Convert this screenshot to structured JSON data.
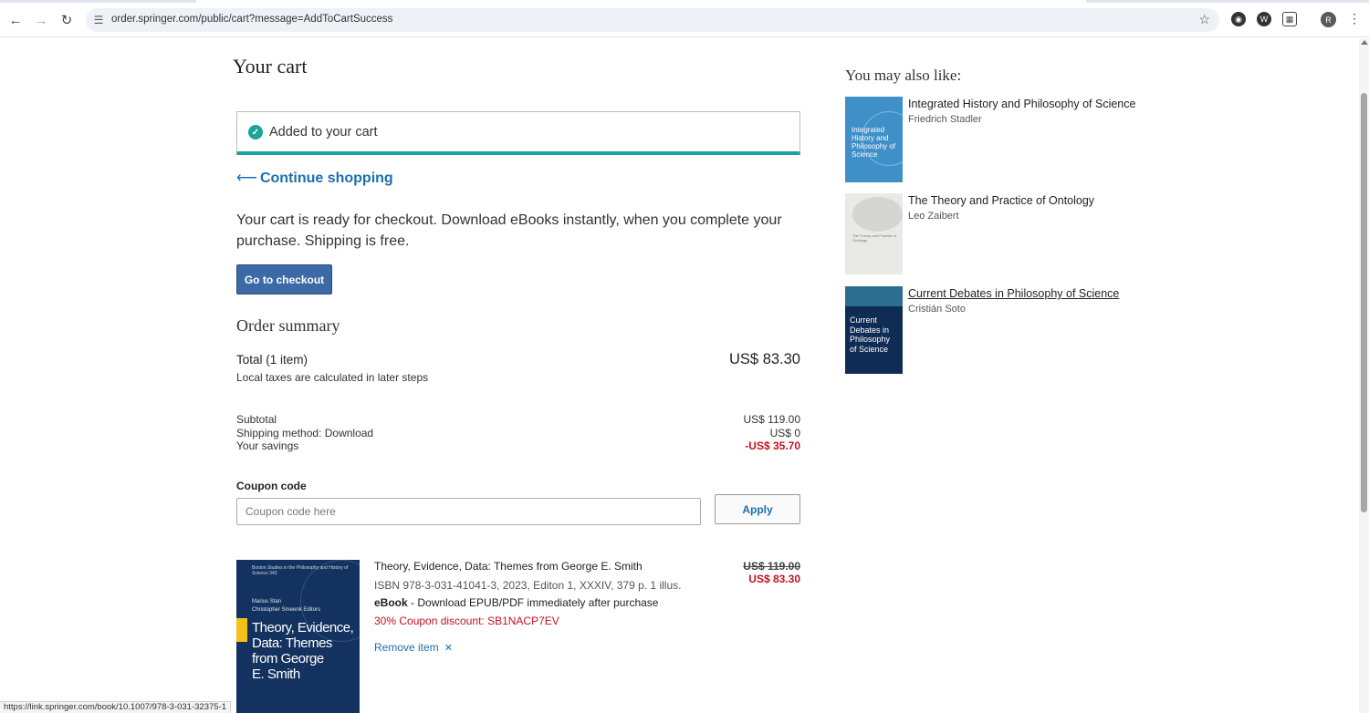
{
  "browser": {
    "url": "order.springer.com/public/cart?message=AddToCartSuccess",
    "status_url": "https://link.springer.com/book/10.1007/978-3-031-32375-1",
    "avatar_letter": "R",
    "icons": [
      "back-icon",
      "forward-icon",
      "reload-icon",
      "site-settings-icon",
      "bookmark-star-icon",
      "extension-icon",
      "menu-kebab-icon"
    ]
  },
  "cart": {
    "title": "Your cart",
    "alert": "Added to your cart",
    "continue": "Continue shopping",
    "ready_text": "Your cart is ready for checkout. Download eBooks instantly, when you complete your purchase. Shipping is free.",
    "checkout_button": "Go to checkout"
  },
  "summary": {
    "title": "Order summary",
    "total_label": "Total (1 item)",
    "total_value": "US$ 83.30",
    "taxes_note": "Local taxes are calculated in later steps",
    "lines": [
      {
        "label": "Subtotal",
        "value": "US$ 119.00"
      },
      {
        "label": "Shipping method: Download",
        "value": "US$ 0"
      },
      {
        "label": "Your savings",
        "value": "-US$ 35.70"
      }
    ],
    "coupon_label": "Coupon code",
    "coupon_placeholder": "Coupon code here",
    "coupon_value": "",
    "apply_button": "Apply"
  },
  "item": {
    "title": "Theory, Evidence, Data: Themes from George E. Smith",
    "isbn": "ISBN 978-3-031-41041-3, 2023, Editon 1, XXXIV, 379 p. 1 illus.",
    "format_bold": "eBook",
    "format_rest": " - Download EPUB/PDF immediately after purchase",
    "discount": "30% Coupon discount: SB1NACP7EV",
    "remove": "Remove item",
    "old_price": "US$ 119.00",
    "new_price": "US$ 83.30",
    "cover": {
      "series": "Boston Studies in the Philosophy and History of Science 343",
      "editors": [
        "Marius Stan",
        "Christopher Smeenk  Editors"
      ],
      "title_lines": [
        "Theory, Evidence,",
        "Data: Themes",
        "from George",
        "E. Smith"
      ]
    }
  },
  "recommendations": {
    "title": "You may also like:",
    "items": [
      {
        "title": "Integrated History and Philosophy of Science",
        "author": "Friedrich Stadler",
        "cover_text": [
          "Integrated",
          "History and",
          "Philosophy of",
          "Science"
        ]
      },
      {
        "title": "The Theory and Practice of Ontology",
        "author": "Leo Zaibert",
        "cover_text": [
          "The Theory and Practice of Ontology"
        ]
      },
      {
        "title": "Current Debates in Philosophy of Science",
        "author": "Cristián Soto",
        "cover_text": [
          "Current",
          "Debates in",
          "Philosophy",
          "of Science"
        ]
      }
    ]
  },
  "colors": {
    "teal": "#1ea29b",
    "link": "#1b6fb0",
    "primary_button": "#3b6aa6",
    "savings_red": "#c1121f"
  }
}
